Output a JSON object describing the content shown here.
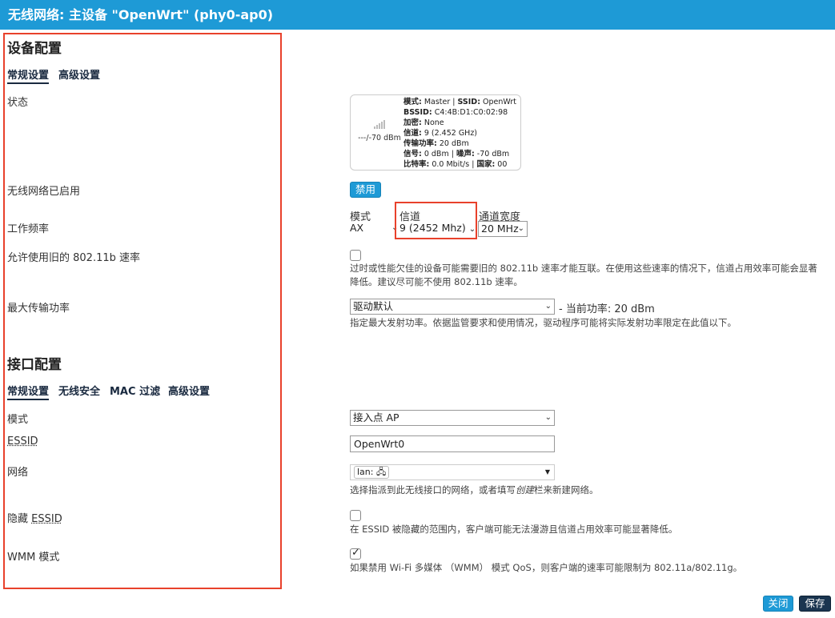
{
  "window": {
    "title": "无线网络: 主设备 \"OpenWrt\" (phy0-ap0)"
  },
  "device": {
    "section_title": "设备配置",
    "tabs": [
      {
        "label": "常规设置",
        "active": true
      },
      {
        "label": "高级设置",
        "active": false
      }
    ],
    "status": {
      "label": "状态",
      "signal_text": "---/-70 dBm",
      "rows": [
        {
          "k1": "模式:",
          "v1": " Master | ",
          "k2": "SSID:",
          "v2": " OpenWrt"
        },
        {
          "k1": "BSSID:",
          "v1": " C4:4B:D1:C0:02:98"
        },
        {
          "k1": "加密:",
          "v1": " None"
        },
        {
          "k1": "信道:",
          "v1": " 9 (2.452 GHz)"
        },
        {
          "k1": "传输功率:",
          "v1": " 20 dBm"
        },
        {
          "k1": "信号:",
          "v1": " 0 dBm | ",
          "k2": "噪声:",
          "v2": " -70 dBm"
        },
        {
          "k1": "比特率:",
          "v1": " 0.0 Mbit/s | ",
          "k2": "国家:",
          "v2": " 00"
        }
      ]
    },
    "enabled": {
      "label": "无线网络已启用",
      "button": "禁用"
    },
    "frequency": {
      "label": "工作频率",
      "mode_label": "模式",
      "mode_value": "AX",
      "channel_label": "信道",
      "channel_value": "9 (2452 Mhz)",
      "width_label": "通道宽度",
      "width_value": "20 MHz"
    },
    "legacy": {
      "label": "允许使用旧的 802.11b 速率",
      "checked": false,
      "desc": "过时或性能欠佳的设备可能需要旧的 802.11b 速率才能互联。在使用这些速率的情况下，信道占用效率可能会显著降低。建议尽可能不使用 802.11b 速率。"
    },
    "txpower": {
      "label": "最大传输功率",
      "value": "驱动默认",
      "current": "- 当前功率: 20 dBm",
      "desc": "指定最大发射功率。依据监管要求和使用情况，驱动程序可能将实际发射功率限定在此值以下。"
    }
  },
  "iface": {
    "section_title": "接口配置",
    "tabs": [
      {
        "label": "常规设置",
        "active": true
      },
      {
        "label": "无线安全",
        "active": false
      },
      {
        "label": "MAC 过滤",
        "active": false
      },
      {
        "label": "高级设置",
        "active": false
      }
    ],
    "mode": {
      "label": "模式",
      "value": "接入点 AP"
    },
    "essid": {
      "label": "ESSID",
      "value": "OpenWrt0"
    },
    "network": {
      "label": "网络",
      "chip": "lan: ",
      "desc_a": "选择指派到此无线接口的网络，或者填写",
      "desc_em": "创建",
      "desc_b": "栏来新建网络。"
    },
    "hidden": {
      "label_a": "隐藏 ",
      "label_b": "ESSID",
      "checked": false,
      "desc": "在 ESSID 被隐藏的范围内，客户端可能无法漫游且信道占用效率可能显著降低。"
    },
    "wmm": {
      "label": "WMM 模式",
      "checked": true,
      "desc": "如果禁用 Wi-Fi 多媒体 （WMM） 模式 QoS，则客户端的速率可能限制为 802.11a/802.11g。"
    }
  },
  "footer": {
    "close": "关闭",
    "save": "保存"
  },
  "colors": {
    "accent": "#1e9ad6",
    "highlight": "#e8412b"
  }
}
